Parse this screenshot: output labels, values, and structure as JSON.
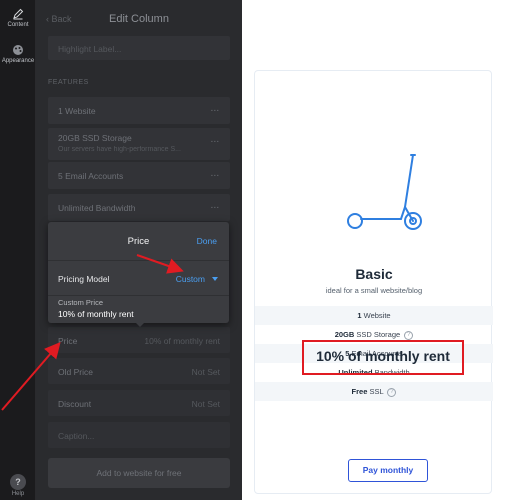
{
  "rail": {
    "content_label": "Content",
    "appearance_label": "Appearance",
    "help_label": "Help",
    "help_glyph": "?"
  },
  "panel": {
    "back_label": "Back",
    "title": "Edit Column",
    "highlight_placeholder": "Highlight Label...",
    "features_heading": "FEATURES",
    "features": [
      {
        "label": "1 Website",
        "sub": ""
      },
      {
        "label": "20GB SSD Storage",
        "sub": "Our servers have high-performance S..."
      },
      {
        "label": "5 Email Accounts",
        "sub": ""
      },
      {
        "label": "Unlimited Bandwidth",
        "sub": ""
      }
    ],
    "more_icon": "⋯",
    "price_label": "Price",
    "price_value": "10% of monthly rent",
    "old_price_label": "Old Price",
    "old_price_value": "Not Set",
    "discount_label": "Discount",
    "discount_value": "Not Set",
    "caption_placeholder": "Caption...",
    "add_button": "Add to website for free"
  },
  "price_popover": {
    "title": "Price",
    "done": "Done",
    "pricing_model_label": "Pricing Model",
    "pricing_model_value": "Custom",
    "custom_price_label": "Custom Price",
    "custom_price_value": "10% of monthly rent"
  },
  "preview": {
    "plan_name": "Basic",
    "plan_desc": "ideal for a small website/blog",
    "features": [
      {
        "bold": "1",
        "text": " Website",
        "help": false
      },
      {
        "bold": "20GB",
        "text": " SSD Storage",
        "help": true
      },
      {
        "bold": "5",
        "text": " Email Accounts",
        "help": false
      },
      {
        "bold": "Unlimited",
        "text": " Bandwidth",
        "help": false
      },
      {
        "bold": "Free",
        "text": " SSL",
        "help": true
      }
    ],
    "help_glyph": "?",
    "price": "10% of monthly rent",
    "pay_button": "Pay monthly"
  },
  "colors": {
    "accent_blue": "#4a9ef0",
    "annotation_red": "#e01b22",
    "cta_blue": "#2f54d8",
    "illustration_blue": "#2f7fe0"
  }
}
